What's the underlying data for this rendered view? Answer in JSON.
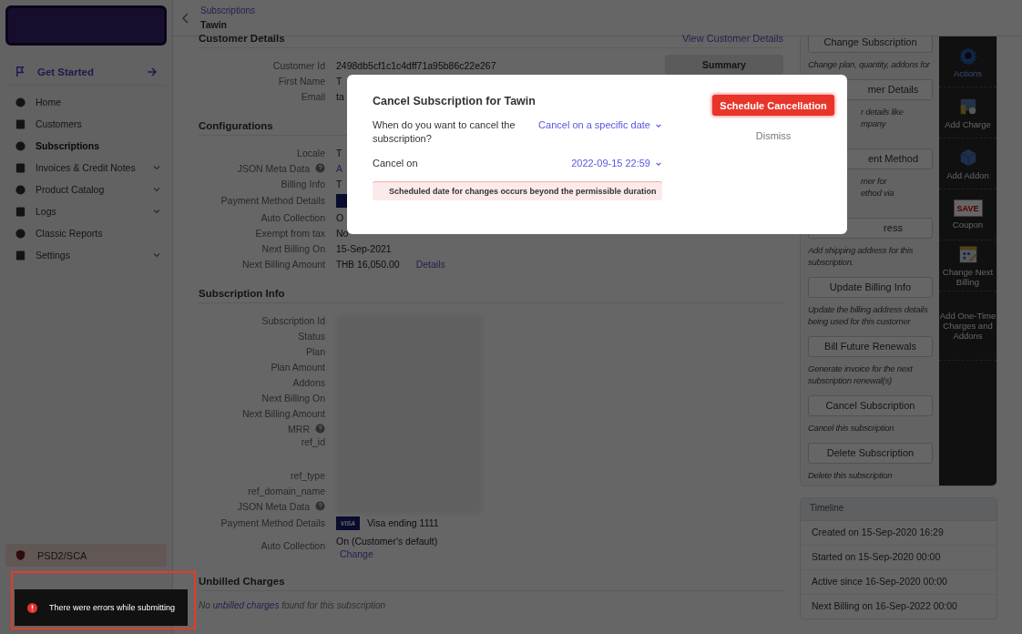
{
  "header": {
    "breadcrumb": "Subscriptions",
    "title": "Tawin"
  },
  "sidebar": {
    "get_started": "Get Started",
    "items": [
      {
        "label": "Home",
        "selected": false,
        "expandable": false
      },
      {
        "label": "Customers",
        "selected": false,
        "expandable": false
      },
      {
        "label": "Subscriptions",
        "selected": true,
        "expandable": false
      },
      {
        "label": "Invoices & Credit Notes",
        "selected": false,
        "expandable": true
      },
      {
        "label": "Product Catalog",
        "selected": false,
        "expandable": true
      },
      {
        "label": "Logs",
        "selected": false,
        "expandable": true
      },
      {
        "label": "Classic Reports",
        "selected": false,
        "expandable": false
      },
      {
        "label": "Settings",
        "selected": false,
        "expandable": true
      }
    ],
    "footer_item": "PSD2/SCA"
  },
  "sections": [
    {
      "title": "Customer Details",
      "link": "View Customer Details",
      "summary": "Summary",
      "rows": [
        {
          "kind": "text",
          "label": "Customer Id",
          "value": "2498db5cf1c1c4dff71a95b86c22e267"
        },
        {
          "kind": "text",
          "label": "First Name",
          "value": "T"
        },
        {
          "kind": "text",
          "label": "Email",
          "value": "ta"
        }
      ]
    },
    {
      "title": "Configurations",
      "rows": [
        {
          "kind": "text",
          "label": "Locale",
          "value": "T"
        },
        {
          "kind": "link",
          "label": "JSON Meta Data",
          "help": true,
          "link": "A"
        },
        {
          "kind": "text",
          "label": "Billing Info",
          "value": "T"
        },
        {
          "kind": "card",
          "label": "Payment Method Details"
        },
        {
          "kind": "text",
          "label": "Auto Collection",
          "value": "O"
        },
        {
          "kind": "text",
          "label": "Exempt from tax",
          "value": "No"
        },
        {
          "kind": "text",
          "label": "Next Billing On",
          "value": "15-Sep-2021"
        },
        {
          "kind": "amount",
          "label": "Next Billing Amount",
          "currency": "THB",
          "value": "16,050.00",
          "link": "Details"
        }
      ]
    },
    {
      "title": "Subscription Info",
      "rows": [
        {
          "kind": "hidden",
          "label": "Subscription Id"
        },
        {
          "kind": "hidden",
          "label": "Status"
        },
        {
          "kind": "hidden",
          "label": "Plan"
        },
        {
          "kind": "hidden",
          "label": "Plan Amount"
        },
        {
          "kind": "hidden",
          "label": "Addons"
        },
        {
          "kind": "hidden",
          "label": "Next Billing On"
        },
        {
          "kind": "hidden",
          "label": "Next Billing Amount"
        },
        {
          "kind": "hidden",
          "label": "MRR",
          "help": true
        },
        {
          "kind": "hidden",
          "label": "ref_id",
          "tall": true
        },
        {
          "kind": "hidden",
          "label": "ref_type"
        },
        {
          "kind": "hidden",
          "label": "ref_domain_name"
        },
        {
          "kind": "hidden",
          "label": "JSON Meta Data",
          "help": true
        },
        {
          "kind": "card",
          "label": "Payment Method Details",
          "brand": "VISA",
          "value": "Visa ending 1111"
        },
        {
          "kind": "text_link",
          "label": "Auto Collection",
          "value": "On (Customer's default)",
          "link": "Change"
        }
      ]
    },
    {
      "title": "Unbilled Charges",
      "empty": {
        "before": "No",
        "link": "unbilled charges",
        "after": "found for this subscription"
      }
    }
  ],
  "actions": {
    "buttons": [
      {
        "label": "Change Subscription",
        "clipped": false,
        "description": [
          {
            "text": "Change plan, quantity, addons for",
            "clipped": false
          }
        ]
      },
      {
        "label": "mer Details",
        "clipped": true,
        "description": [
          {
            "text": "r details like",
            "clipped": true
          },
          {
            "text": "mpany",
            "clipped": true
          }
        ]
      },
      {
        "label": "ent Method",
        "clipped": true,
        "description": [
          {
            "text": "mer for",
            "clipped": true
          },
          {
            "text": "ethod via",
            "clipped": true
          }
        ]
      },
      {
        "label": "ress",
        "clipped": true,
        "description": [
          {
            "text": "Add shipping address for this subscription.",
            "clipped": false
          }
        ]
      },
      {
        "label": "Update Billing Info",
        "clipped": false,
        "description": [
          {
            "text": "Update the billing address details being used for this customer",
            "clipped": false
          }
        ]
      },
      {
        "label": "Bill Future Renewals",
        "clipped": false,
        "description": [
          {
            "text": "Generate invoice for the next subscription renewal(s)",
            "clipped": false
          }
        ]
      },
      {
        "label": "Cancel Subscription",
        "clipped": false,
        "description": [
          {
            "text": "Cancel this subscription",
            "clipped": false
          }
        ]
      },
      {
        "label": "Delete Subscription",
        "clipped": false,
        "description": [
          {
            "text": "Delete this subscription",
            "clipped": false
          }
        ]
      }
    ],
    "tools": [
      {
        "label": "Actions",
        "selected": true
      },
      {
        "label": "Add Charge",
        "selected": false
      },
      {
        "label": "Add Addon",
        "selected": false
      },
      {
        "label": "Coupon",
        "selected": false,
        "icon_text": "SAVE"
      },
      {
        "label": "Change Next Billing",
        "selected": false
      },
      {
        "label": "Add One-Time Charges and Addons",
        "selected": false
      }
    ]
  },
  "timeline": {
    "title": "Timeline",
    "events": [
      "Created on 15-Sep-2020 16:29",
      "Started on 15-Sep-2020 00:00",
      "Active since 16-Sep-2020 00:00",
      "Next Billing on 16-Sep-2022 00:00"
    ]
  },
  "modal": {
    "title": "Cancel Subscription for Tawin",
    "primary": "Schedule Cancellation",
    "dismiss": "Dismiss",
    "fields": [
      {
        "label": "When do you want to cancel the subscription?",
        "value": "Cancel on a specific date"
      },
      {
        "label": "Cancel on",
        "value": "2022-09-15 22:59"
      }
    ],
    "error": "Scheduled date for changes occurs beyond the permissible duration"
  },
  "toast": {
    "message": "There were errors while submitting",
    "highlighted": true
  }
}
